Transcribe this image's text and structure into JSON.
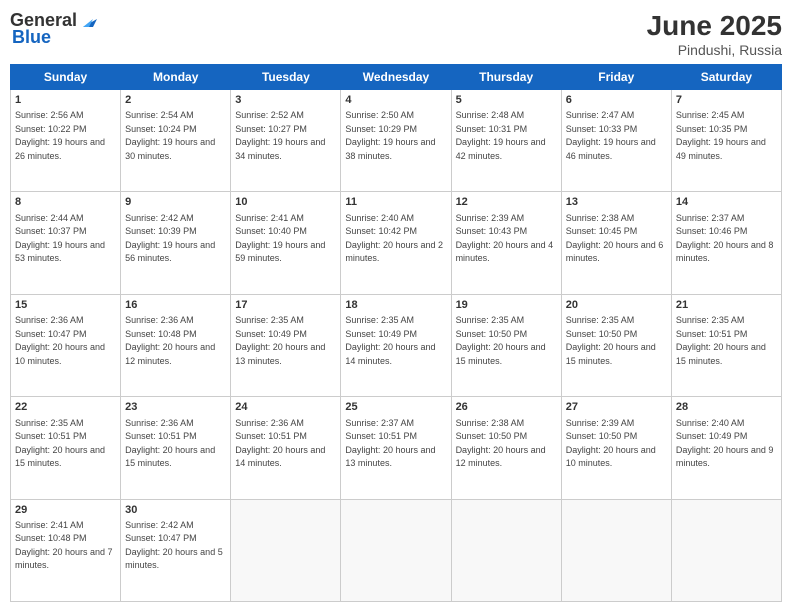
{
  "logo": {
    "general": "General",
    "blue": "Blue"
  },
  "title": "June 2025",
  "subtitle": "Pindushi, Russia",
  "days_of_week": [
    "Sunday",
    "Monday",
    "Tuesday",
    "Wednesday",
    "Thursday",
    "Friday",
    "Saturday"
  ],
  "weeks": [
    [
      {
        "day": "1",
        "sunrise": "2:56 AM",
        "sunset": "10:22 PM",
        "daylight": "19 hours and 26 minutes."
      },
      {
        "day": "2",
        "sunrise": "2:54 AM",
        "sunset": "10:24 PM",
        "daylight": "19 hours and 30 minutes."
      },
      {
        "day": "3",
        "sunrise": "2:52 AM",
        "sunset": "10:27 PM",
        "daylight": "19 hours and 34 minutes."
      },
      {
        "day": "4",
        "sunrise": "2:50 AM",
        "sunset": "10:29 PM",
        "daylight": "19 hours and 38 minutes."
      },
      {
        "day": "5",
        "sunrise": "2:48 AM",
        "sunset": "10:31 PM",
        "daylight": "19 hours and 42 minutes."
      },
      {
        "day": "6",
        "sunrise": "2:47 AM",
        "sunset": "10:33 PM",
        "daylight": "19 hours and 46 minutes."
      },
      {
        "day": "7",
        "sunrise": "2:45 AM",
        "sunset": "10:35 PM",
        "daylight": "19 hours and 49 minutes."
      }
    ],
    [
      {
        "day": "8",
        "sunrise": "2:44 AM",
        "sunset": "10:37 PM",
        "daylight": "19 hours and 53 minutes."
      },
      {
        "day": "9",
        "sunrise": "2:42 AM",
        "sunset": "10:39 PM",
        "daylight": "19 hours and 56 minutes."
      },
      {
        "day": "10",
        "sunrise": "2:41 AM",
        "sunset": "10:40 PM",
        "daylight": "19 hours and 59 minutes."
      },
      {
        "day": "11",
        "sunrise": "2:40 AM",
        "sunset": "10:42 PM",
        "daylight": "20 hours and 2 minutes."
      },
      {
        "day": "12",
        "sunrise": "2:39 AM",
        "sunset": "10:43 PM",
        "daylight": "20 hours and 4 minutes."
      },
      {
        "day": "13",
        "sunrise": "2:38 AM",
        "sunset": "10:45 PM",
        "daylight": "20 hours and 6 minutes."
      },
      {
        "day": "14",
        "sunrise": "2:37 AM",
        "sunset": "10:46 PM",
        "daylight": "20 hours and 8 minutes."
      }
    ],
    [
      {
        "day": "15",
        "sunrise": "2:36 AM",
        "sunset": "10:47 PM",
        "daylight": "20 hours and 10 minutes."
      },
      {
        "day": "16",
        "sunrise": "2:36 AM",
        "sunset": "10:48 PM",
        "daylight": "20 hours and 12 minutes."
      },
      {
        "day": "17",
        "sunrise": "2:35 AM",
        "sunset": "10:49 PM",
        "daylight": "20 hours and 13 minutes."
      },
      {
        "day": "18",
        "sunrise": "2:35 AM",
        "sunset": "10:49 PM",
        "daylight": "20 hours and 14 minutes."
      },
      {
        "day": "19",
        "sunrise": "2:35 AM",
        "sunset": "10:50 PM",
        "daylight": "20 hours and 15 minutes."
      },
      {
        "day": "20",
        "sunrise": "2:35 AM",
        "sunset": "10:50 PM",
        "daylight": "20 hours and 15 minutes."
      },
      {
        "day": "21",
        "sunrise": "2:35 AM",
        "sunset": "10:51 PM",
        "daylight": "20 hours and 15 minutes."
      }
    ],
    [
      {
        "day": "22",
        "sunrise": "2:35 AM",
        "sunset": "10:51 PM",
        "daylight": "20 hours and 15 minutes."
      },
      {
        "day": "23",
        "sunrise": "2:36 AM",
        "sunset": "10:51 PM",
        "daylight": "20 hours and 15 minutes."
      },
      {
        "day": "24",
        "sunrise": "2:36 AM",
        "sunset": "10:51 PM",
        "daylight": "20 hours and 14 minutes."
      },
      {
        "day": "25",
        "sunrise": "2:37 AM",
        "sunset": "10:51 PM",
        "daylight": "20 hours and 13 minutes."
      },
      {
        "day": "26",
        "sunrise": "2:38 AM",
        "sunset": "10:50 PM",
        "daylight": "20 hours and 12 minutes."
      },
      {
        "day": "27",
        "sunrise": "2:39 AM",
        "sunset": "10:50 PM",
        "daylight": "20 hours and 10 minutes."
      },
      {
        "day": "28",
        "sunrise": "2:40 AM",
        "sunset": "10:49 PM",
        "daylight": "20 hours and 9 minutes."
      }
    ],
    [
      {
        "day": "29",
        "sunrise": "2:41 AM",
        "sunset": "10:48 PM",
        "daylight": "20 hours and 7 minutes."
      },
      {
        "day": "30",
        "sunrise": "2:42 AM",
        "sunset": "10:47 PM",
        "daylight": "20 hours and 5 minutes."
      },
      null,
      null,
      null,
      null,
      null
    ]
  ]
}
